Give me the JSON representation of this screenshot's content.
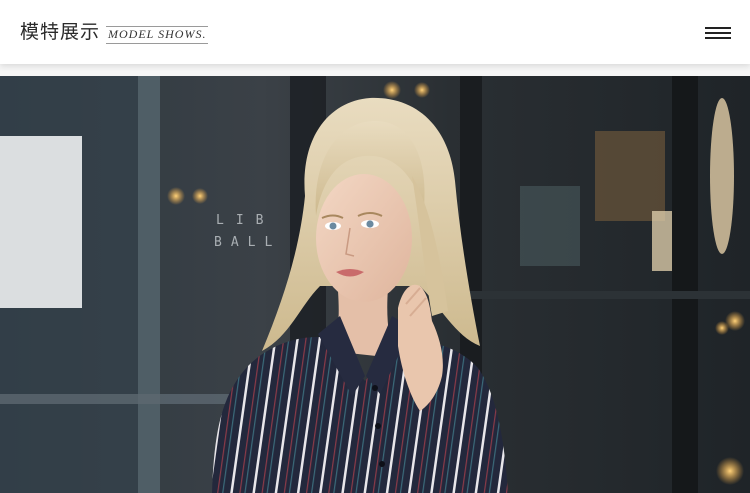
{
  "header": {
    "title_zh": "模特展示",
    "title_en": "MODEL SHOWS.",
    "menu_icon": "hamburger-menu-icon"
  },
  "hero": {
    "image": "model-photo",
    "window_sign": {
      "line1": "LIB",
      "line2": "BALL"
    }
  }
}
